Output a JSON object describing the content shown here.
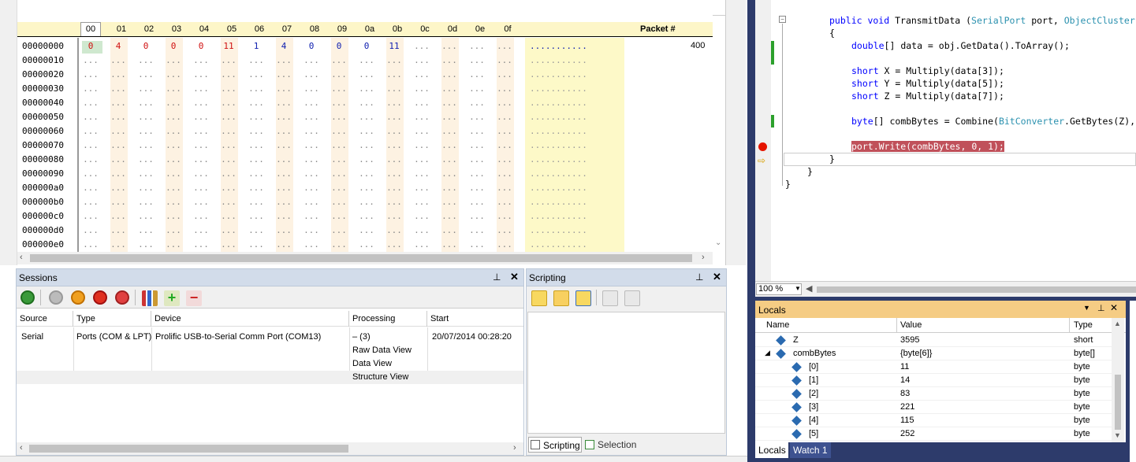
{
  "hex": {
    "columns": [
      "00",
      "01",
      "02",
      "03",
      "04",
      "05",
      "06",
      "07",
      "08",
      "09",
      "0a",
      "0b",
      "0c",
      "0d",
      "0e",
      "0f"
    ],
    "packet_header": "Packet #",
    "rows": [
      "00000000",
      "00000010",
      "00000020",
      "00000030",
      "00000040",
      "00000050",
      "00000060",
      "00000070",
      "00000080",
      "00000090",
      "000000a0",
      "000000b0",
      "000000c0",
      "000000d0",
      "000000e0"
    ],
    "row0_values": [
      "0",
      "4",
      "0",
      "0",
      "0",
      "11",
      "1",
      "4",
      "0",
      "0",
      "0",
      "11",
      "...",
      "...",
      "...",
      "..."
    ],
    "row0_ascii": "...........",
    "empty_cell": "...",
    "packet_number": "400"
  },
  "sessions": {
    "title": "Sessions",
    "headers": [
      "Source",
      "Type",
      "Device",
      "Processing",
      "Start"
    ],
    "row": {
      "source": "Serial",
      "type": "Ports (COM & LPT)",
      "device": "Prolific USB-to-Serial Comm Port (COM13)",
      "processing": "– (3)",
      "start": "20/07/2014 00:28:20",
      "views": [
        "Raw Data View",
        "Data View",
        "Structure View"
      ]
    }
  },
  "scripting": {
    "title": "Scripting",
    "tabs": [
      "Scripting",
      "Selection"
    ]
  },
  "code": {
    "lines": [
      {
        "text": "public void TransmitData (SerialPort port, ObjectCluster"
      },
      {
        "text": "{"
      },
      {
        "text": "double[] data = obj.GetData().ToArray();"
      },
      {
        "text": "short X = Multiply(data[3]);"
      },
      {
        "text": "short Y = Multiply(data[5]);"
      },
      {
        "text": "short Z = Multiply(data[7]);"
      },
      {
        "text": "byte[] combBytes = Combine(BitConverter.GetBytes(Z),"
      },
      {
        "text": "port.Write(combBytes, 0, 1);"
      },
      {
        "text": "}"
      },
      {
        "text": "}"
      },
      {
        "text": "}"
      }
    ],
    "zoom": "100 %"
  },
  "locals": {
    "title": "Locals",
    "headers": [
      "Name",
      "Value",
      "Type"
    ],
    "rows": [
      {
        "name": "Z",
        "value": "3595",
        "type": "short"
      },
      {
        "name": "combBytes",
        "value": "{byte[6]}",
        "type": "byte[]"
      },
      {
        "name": "[0]",
        "value": "11",
        "type": "byte"
      },
      {
        "name": "[1]",
        "value": "14",
        "type": "byte"
      },
      {
        "name": "[2]",
        "value": "83",
        "type": "byte"
      },
      {
        "name": "[3]",
        "value": "221",
        "type": "byte"
      },
      {
        "name": "[4]",
        "value": "115",
        "type": "byte"
      },
      {
        "name": "[5]",
        "value": "252",
        "type": "byte"
      }
    ],
    "tabs": [
      "Locals",
      "Watch 1"
    ]
  },
  "colors": {
    "vs_blue": "#2d3b6b",
    "breakpoint": "#e51400",
    "highlight": "#c0505a",
    "hex_header": "#fdf6c8",
    "ascii_bg": "#fdf9c8"
  }
}
